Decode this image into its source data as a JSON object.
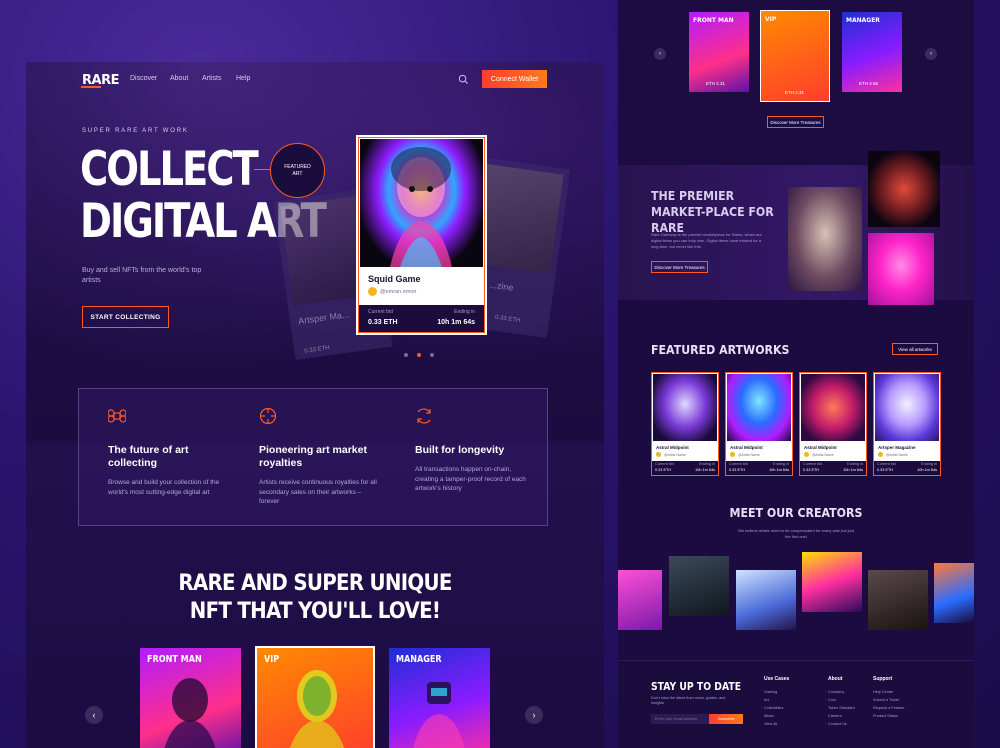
{
  "colors": {
    "accent": "#ff5a1f",
    "accent_gradient_end": "#ff7a1a",
    "background": "#1b0b40"
  },
  "nav": {
    "logo": "RARE",
    "links": [
      "Discover",
      "About",
      "Artists",
      "Help"
    ],
    "connect_label": "Connect Wallet",
    "search_icon": "search-icon"
  },
  "hero": {
    "eyebrow": "SUPER RARE ART WORK",
    "title_line1": "COLLECT",
    "title_line2": "DIGITAL ART",
    "subtitle": "Buy and sell NFTs from the world's top artists",
    "cta_label": "START COLLECTING",
    "badge_line1": "FEATURED",
    "badge_line2": "ART",
    "side_card_left": {
      "title": "Artsper Ma...",
      "price": "0.33 ETH"
    },
    "side_card_right": {
      "title": "...zine",
      "price": "0.33 ETH"
    },
    "main_card": {
      "name": "Squid Game",
      "handle": "@emran.emon",
      "bid_label": "Current bid",
      "bid_value": "0.33 ETH",
      "ending_label": "Ending in",
      "ending_value": "10h 1m 64s"
    },
    "carousel_pages": 3,
    "carousel_active": 2
  },
  "features": [
    {
      "icon": "command-icon",
      "title": "The future of art collecting",
      "desc": "Browse and build your collection of the world's most cutting-edge digital art"
    },
    {
      "icon": "crosshair-icon",
      "title": "Pioneering art market royalties",
      "desc": "Artists receive continuous royalties for all secondary sales on their artworks – forever"
    },
    {
      "icon": "refresh-icon",
      "title": "Built for longevity",
      "desc": "All transactions happen on-chain, creating a tamper-proof record of each artwork's history"
    }
  ],
  "nft_section": {
    "title_line1": "RARE AND SUPER UNIQUE",
    "title_line2": "NFT THAT YOU'LL LOVE!",
    "cards": [
      {
        "label": "FRONT MAN"
      },
      {
        "label": "VIP"
      },
      {
        "label": "MANAGER"
      }
    ],
    "prev_label": "‹",
    "next_label": "›"
  },
  "right": {
    "mini_cards": [
      {
        "label": "FRONT MAN",
        "tag": "ETH 2.31"
      },
      {
        "label": "VIP",
        "tag": "ETH 2.31"
      },
      {
        "label": "MANAGER",
        "tag": "ETH 4.56"
      }
    ],
    "discover_label": "Discover More Treasures",
    "premier_title": "THE PREMIER MARKET-PLACE FOR RARE",
    "premier_desc": "Rare Gateway is the premier marketplace for Rares, which are digital items you can truly own. Digital items have existed for a long time, but never like this.",
    "premier_btn": "Discover More Treasures",
    "featured_title": "FEATURED ARTWORKS",
    "view_all_label": "View all artworks",
    "artworks": [
      {
        "name": "Astral Midpoint",
        "handle": "@Artist.Name",
        "bid_label": "Current bid",
        "bid": "0.33 ETH",
        "end_label": "Ending in",
        "end": "10h 1m 64s"
      },
      {
        "name": "Astral Midpoint",
        "handle": "@Artist.Name",
        "bid_label": "Current bid",
        "bid": "0.33 ETH",
        "end_label": "Ending in",
        "end": "10h 1m 64s"
      },
      {
        "name": "Astral Midpoint",
        "handle": "@Artist.Name",
        "bid_label": "Current bid",
        "bid": "0.33 ETH",
        "end_label": "Ending in",
        "end": "10h 1m 64s"
      },
      {
        "name": "Artsper Magazine",
        "handle": "@Artist.Name",
        "bid_label": "Current bid",
        "bid": "0.33 ETH",
        "end_label": "Ending in",
        "end": "10h 1m 64s"
      }
    ],
    "creators_title": "MEET OUR CREATORS",
    "creators_desc": "We believe artists need to be compensated for every sale,not just the first one!",
    "stay_title": "STAY UP TO DATE",
    "stay_desc": "Don't miss the latest from news, guides, and insights",
    "email_placeholder": "Enter your email address",
    "subscribe_label": "Subscribe",
    "footer_cols": [
      {
        "heading": "Use Cases",
        "items": [
          "Gaming",
          "Art",
          "Collectibles",
          "Music",
          "View All"
        ]
      },
      {
        "heading": "About",
        "items": [
          "Company",
          "Coin",
          "Token Standard",
          "Careers",
          "Contact Us"
        ]
      },
      {
        "heading": "Support",
        "items": [
          "Help Center",
          "Submit a Ticket",
          "Request a Feature",
          "Product Status"
        ]
      }
    ]
  }
}
